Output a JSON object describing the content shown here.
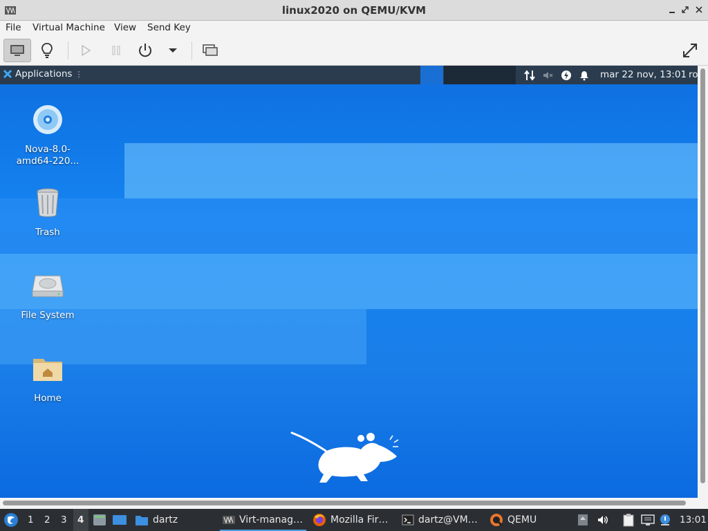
{
  "window": {
    "title": "linux2020 on QEMU/KVM",
    "controls": [
      "_",
      "⤢",
      "✕"
    ]
  },
  "menu": [
    "File",
    "Virtual Machine",
    "View",
    "Send Key"
  ],
  "guest_panel": {
    "applications_label": "Applications",
    "clock": "mar 22 nov, 13:01",
    "user": "ro"
  },
  "desktop_icons": [
    {
      "label": "Nova-8.0-\namd64-220..."
    },
    {
      "label": "Trash"
    },
    {
      "label": "File System"
    },
    {
      "label": "Home"
    }
  ],
  "taskbar": {
    "workspaces": [
      "1",
      "2",
      "3",
      "4"
    ],
    "active_workspace": "4",
    "folder_label": "dartz",
    "tasks": [
      {
        "label": "Virt-manag…"
      },
      {
        "label": "Mozilla Fir…"
      },
      {
        "label": "dartz@VM…"
      },
      {
        "label": "QEMU"
      }
    ],
    "clock": "13:01"
  },
  "colors": {
    "desktop": "#1584f0",
    "panel": "#2b3c4e",
    "taskbar": "#2b2f33",
    "accent": "#4a9de2"
  }
}
